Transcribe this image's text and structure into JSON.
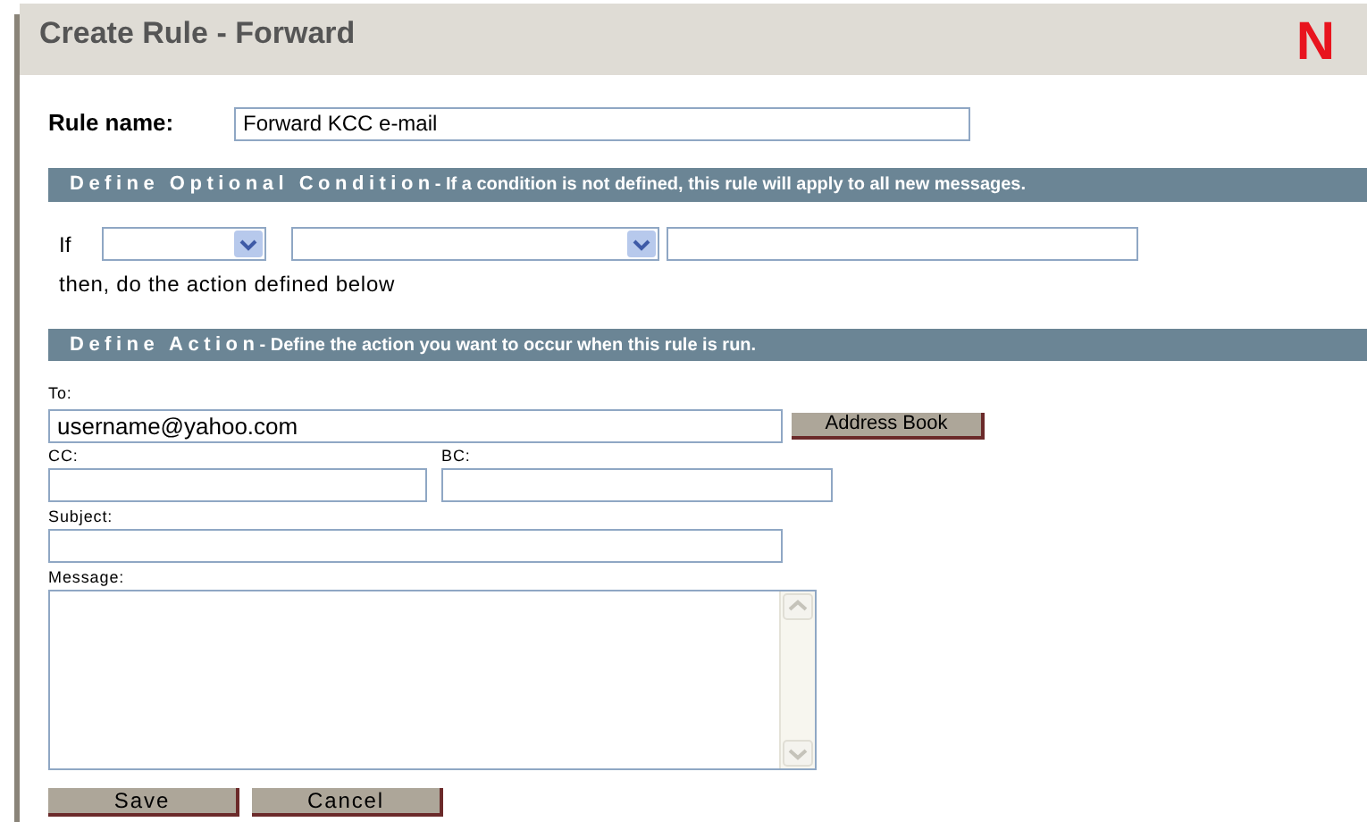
{
  "window": {
    "title": "Create Rule - Forward",
    "logo": "N"
  },
  "rule_name": {
    "label": "Rule name:",
    "value": "Forward KCC e-mail"
  },
  "condition_section": {
    "heading": "Define Optional Condition",
    "note": "- If a condition is not defined, this rule will apply to all new messages."
  },
  "condition": {
    "if_label": "If",
    "then_text": "then, do the action defined below"
  },
  "action_section": {
    "heading": "Define Action",
    "note": "- Define the action you want to occur when this rule is run."
  },
  "to": {
    "label": "To:",
    "value": "username@yahoo.com",
    "button": "Address Book"
  },
  "cc": {
    "label": "CC:"
  },
  "bc": {
    "label": "BC:"
  },
  "subject": {
    "label": "Subject:"
  },
  "message": {
    "label": "Message:"
  },
  "buttons": [
    "Save",
    "Cancel"
  ]
}
